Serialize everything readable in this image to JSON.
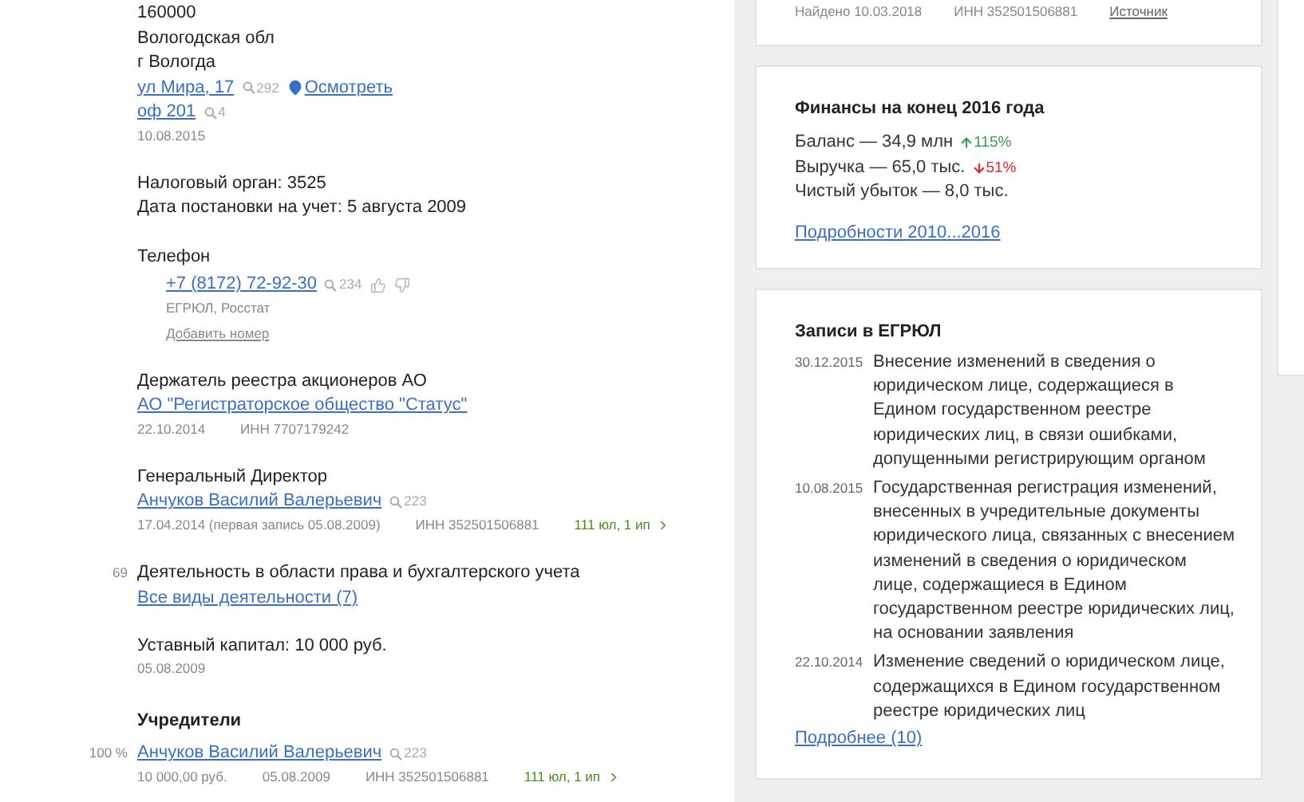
{
  "address": {
    "lines": [
      "160000",
      "Вологодская обл",
      "г Вологда"
    ],
    "street": {
      "text": "ул Мира, 17",
      "count": "292"
    },
    "view_link": "Осмотреть",
    "office": {
      "text": "оф 201",
      "count": "4"
    },
    "date": "10.08.2015"
  },
  "tax": [
    "Налоговый орган: 3525",
    "Дата постановки на учет: 5 августа 2009"
  ],
  "phone": {
    "label": "Телефон",
    "number": "+7 (8172) 72-92-30",
    "count": "234",
    "source": "ЕГРЮЛ, Росстат",
    "add_link": "Добавить номер"
  },
  "registry_holder": {
    "label": "Держатель реестра акционеров АО",
    "name": "АО \"Регистраторское общество \"Статус\"",
    "date": "22.10.2014",
    "inn": "ИНН 7707179242"
  },
  "director": {
    "label": "Генеральный Директор",
    "name": "Анчуков Василий Валерьевич",
    "count": "223",
    "date": "17.04.2014 (первая запись 05.08.2009)",
    "inn": "ИНН 352501506881",
    "links": "111 юл, 1 ип"
  },
  "activity": {
    "code": "69",
    "text": "Деятельность в области права и бухгалтерского учета",
    "link": "Все виды деятельности (7)"
  },
  "capital": {
    "text": "Уставный капитал: 10 000 руб.",
    "date": "05.08.2009"
  },
  "founders": {
    "title": "Учредители",
    "items": [
      {
        "share": "100 %",
        "name": "Анчуков Василий Валерьевич",
        "count": "223",
        "amount": "10 000,00 руб.",
        "date": "05.08.2009",
        "inn": "ИНН 352501506881",
        "links": "111 юл, 1 ип"
      }
    ]
  },
  "found": {
    "date": "Найдено 10.03.2018",
    "inn": "ИНН 352501506881",
    "source": "Источник"
  },
  "finances": {
    "title": "Финансы на конец 2016 года",
    "rows": [
      {
        "text": "Баланс — 34,9 млн",
        "rising": true,
        "change": "115%"
      },
      {
        "text": "Выручка — 65,0 тыс.",
        "rising": false,
        "change": "51%"
      },
      {
        "text": "Чистый убыток — 8,0 тыс."
      }
    ],
    "link": "Подробности 2010...2016"
  },
  "egrul": {
    "title": "Записи в ЕГРЮЛ",
    "entries": [
      {
        "date": "30.12.2015",
        "text": "Внесение изменений в сведения о юридическом лице, содержащиеся в Едином государственном реестре юридических лиц, в связи ошибками, допущенными регистрирующим органом"
      },
      {
        "date": "10.08.2015",
        "text": "Государственная регистрация изменений, внесенных в учредительные документы юридического лица, связанных с внесением изменений в сведения о юридическом лице, содержащиеся в Едином государственном реестре юридических лиц, на основании заявления"
      },
      {
        "date": "22.10.2014",
        "text": "Изменение сведений о юридическом лице, содержащихся в Едином государственном реестре юридических лиц"
      }
    ],
    "link": "Подробнее (10)"
  }
}
